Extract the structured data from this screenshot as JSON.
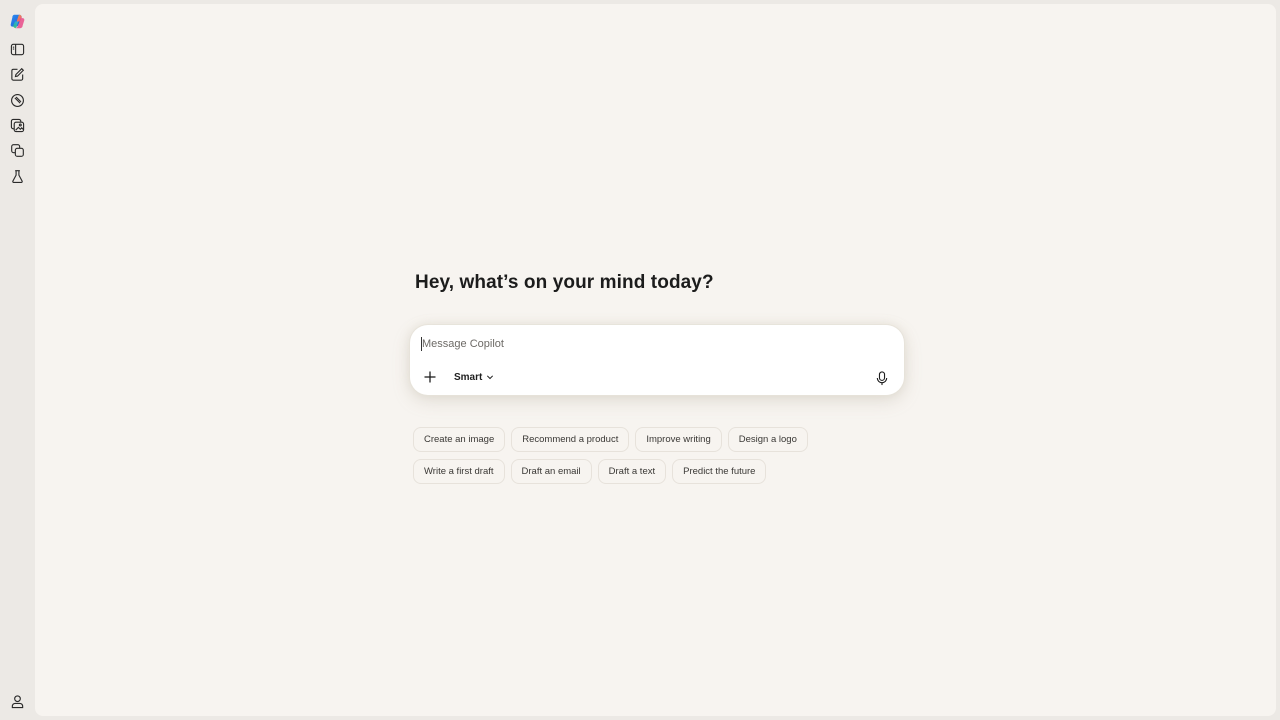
{
  "app": {
    "name": "Copilot"
  },
  "sidebar": {
    "icons": [
      "copilot-logo-icon",
      "sidebar-toggle-icon",
      "new-chat-icon",
      "discover-icon",
      "imagine-icon",
      "pages-icon",
      "labs-icon",
      "profile-icon"
    ]
  },
  "main": {
    "greeting": "Hey, what’s on your mind today?"
  },
  "composer": {
    "placeholder": "Message Copilot",
    "value": "",
    "mode_label": "Smart"
  },
  "suggestions": {
    "row1": [
      "Create an image",
      "Recommend a product",
      "Improve writing",
      "Design a logo"
    ],
    "row2": [
      "Write a first draft",
      "Draft an email",
      "Draft a text",
      "Predict the future"
    ]
  },
  "colors": {
    "rail_bg": "#ECE9E5",
    "panel_bg": "#F7F4F0",
    "composer_bg": "#FFFFFF",
    "chip_border": "#E7E2DB"
  }
}
